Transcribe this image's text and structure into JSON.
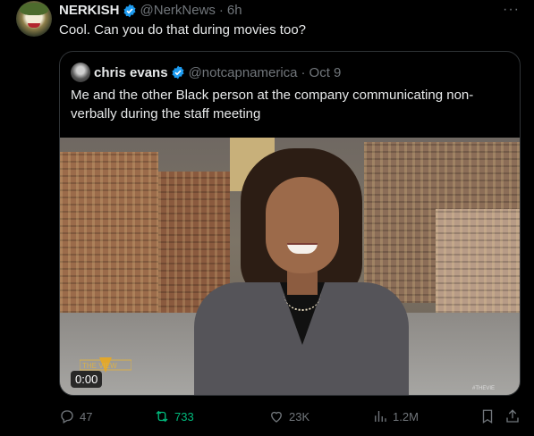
{
  "tweet": {
    "author_name": "NERKISH",
    "handle": "@NerkNews",
    "separator": "·",
    "age": "6h",
    "more": "···",
    "text": "Cool. Can you do that during movies too?"
  },
  "quoted": {
    "author_name": "chris evans",
    "handle": "@notcapnamerica",
    "separator": "·",
    "date": "Oct 9",
    "text": "Me and the other Black person at the company communicating non-verbally during the staff meeting",
    "video": {
      "time": "0:00",
      "logo": "THE VIEW",
      "watermark": "#THEVIE"
    }
  },
  "actions": {
    "replies": "47",
    "reposts": "733",
    "likes": "23K",
    "views": "1.2M"
  },
  "colors": {
    "background": "#000000",
    "muted": "#71767b",
    "verified": "#1d9bf0",
    "repost_active": "#00ba7c"
  }
}
